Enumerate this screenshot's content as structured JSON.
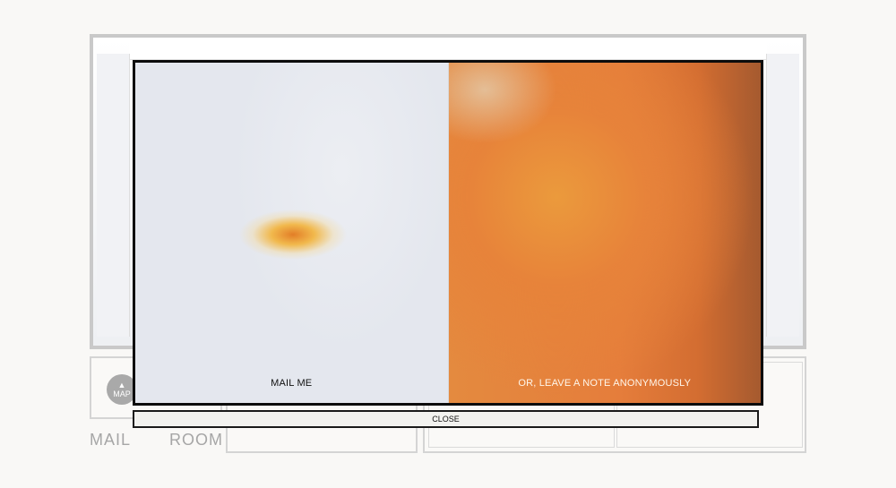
{
  "background": {
    "map_button_label": "MAP",
    "room_labels": [
      "MAIL",
      "ROOM"
    ]
  },
  "modal": {
    "options": [
      {
        "label": "MAIL ME"
      },
      {
        "label": "OR, LEAVE A NOTE ANONYMOUSLY"
      }
    ],
    "close_label": "CLOSE"
  },
  "colors": {
    "modal_border": "#0c0c0c",
    "accent_orange": "#e57d3b",
    "page_background": "#f9f8f6"
  }
}
